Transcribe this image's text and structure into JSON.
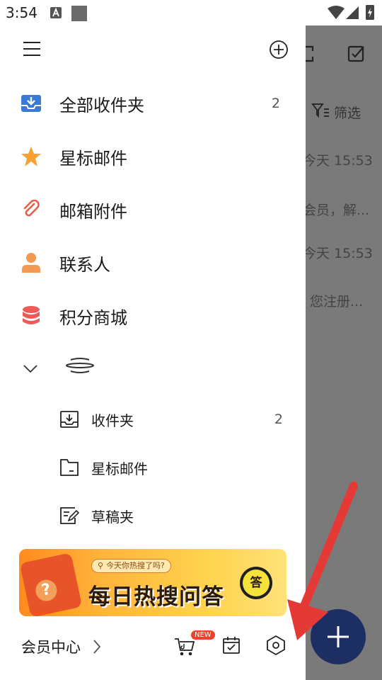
{
  "status_bar": {
    "time": "3:54"
  },
  "background": {
    "filter_label": "筛选",
    "row1_time": "今天 15:53",
    "row1_snippet": "会员，解...",
    "row2_time": "今天 15:53",
    "row2_snippet": "您注册..."
  },
  "drawer": {
    "nav_items": [
      {
        "label": "全部收件夹",
        "count": "2",
        "icon": "inbox-download-icon"
      },
      {
        "label": "星标邮件",
        "count": "",
        "icon": "star-icon"
      },
      {
        "label": "邮箱附件",
        "count": "",
        "icon": "paperclip-icon"
      },
      {
        "label": "联系人",
        "count": "",
        "icon": "person-icon"
      },
      {
        "label": "积分商城",
        "count": "",
        "icon": "coins-icon"
      }
    ],
    "folders": [
      {
        "label": "收件夹",
        "count": "2",
        "icon": "inbox-icon"
      },
      {
        "label": "星标邮件",
        "count": "",
        "icon": "folder-icon"
      },
      {
        "label": "草稿夹",
        "count": "",
        "icon": "draft-icon"
      }
    ],
    "banner": {
      "bubble_text": "今天你热搜了吗?",
      "title": "每日热搜问答",
      "badge": "答"
    },
    "footer": {
      "vip_label": "会员中心",
      "new_badge": "NEW"
    }
  },
  "colors": {
    "accent_blue": "#3a7bd5",
    "star_orange": "#f7a133",
    "link_red": "#e8604a",
    "person_orange": "#f39a52",
    "coins_red": "#ee5a5a",
    "fab_navy": "#1c2e62",
    "arrow_red": "#e53935"
  }
}
